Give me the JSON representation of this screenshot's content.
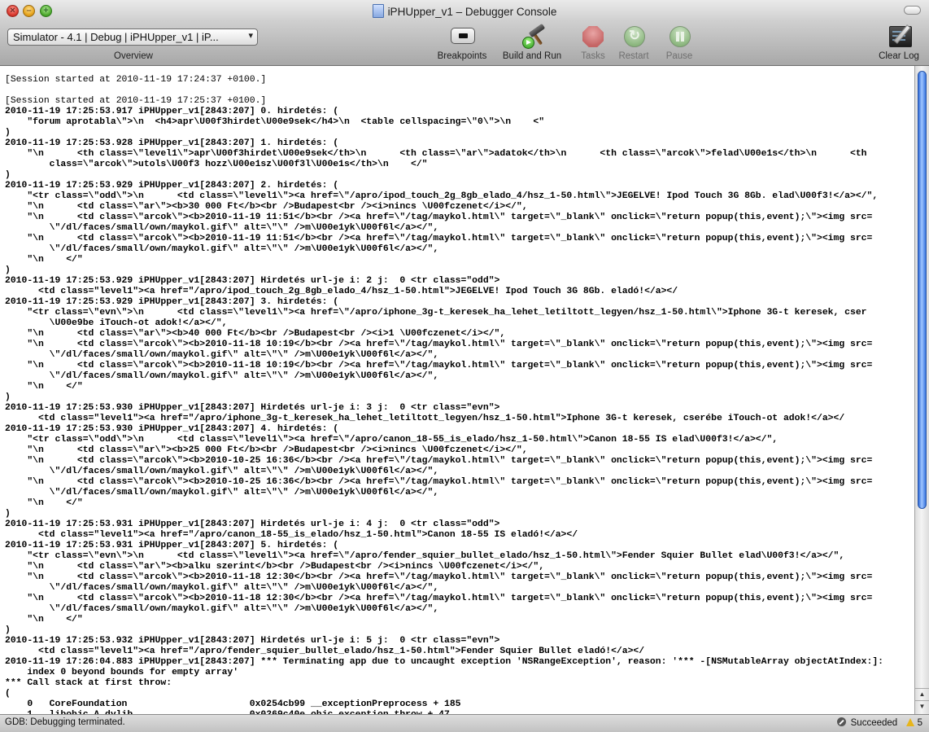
{
  "window": {
    "title": "iPHUpper_v1 – Debugger Console"
  },
  "toolbar": {
    "overview_selector": "Simulator - 4.1 | Debug | iPHUpper_v1 | iP...",
    "overview_label": "Overview",
    "items": [
      {
        "label": "Breakpoints",
        "icon": "breakpoints-icon",
        "enabled": true
      },
      {
        "label": "Build and Run",
        "icon": "hammer-play-icon",
        "enabled": true
      },
      {
        "label": "Tasks",
        "icon": "stop-icon",
        "enabled": false
      },
      {
        "label": "Restart",
        "icon": "restart-icon",
        "enabled": false
      },
      {
        "label": "Pause",
        "icon": "pause-icon",
        "enabled": false
      },
      {
        "label": "Clear Log",
        "icon": "clear-log-icon",
        "enabled": true
      }
    ]
  },
  "console": {
    "lines": [
      {
        "t": "[Session started at 2010-11-19 17:24:37 +0100.]",
        "b": false
      },
      {
        "t": "",
        "b": false
      },
      {
        "t": "[Session started at 2010-11-19 17:25:37 +0100.]",
        "b": false
      },
      {
        "t": "2010-11-19 17:25:53.917 iPHUpper_v1[2843:207] 0. hirdetés: (",
        "b": true
      },
      {
        "t": "    \"forum aprotabla\\\">\\n  <h4>apr\\U00f3hirdet\\U00e9sek</h4>\\n  <table cellspacing=\\\"0\\\">\\n    <\"",
        "b": true
      },
      {
        "t": ")",
        "b": true
      },
      {
        "t": "2010-11-19 17:25:53.928 iPHUpper_v1[2843:207] 1. hirdetés: (",
        "b": true
      },
      {
        "t": "    \"\\n      <th class=\\\"level1\\\">apr\\U00f3hirdet\\U00e9sek</th>\\n      <th class=\\\"ar\\\">adatok</th>\\n      <th class=\\\"arcok\\\">felad\\U00e1s</th>\\n      <th",
        "b": true
      },
      {
        "t": "        class=\\\"arcok\\\">utols\\U00f3 hozz\\U00e1sz\\U00f3l\\U00e1s</th>\\n    </\"",
        "b": true
      },
      {
        "t": ")",
        "b": true
      },
      {
        "t": "2010-11-19 17:25:53.929 iPHUpper_v1[2843:207] 2. hirdetés: (",
        "b": true
      },
      {
        "t": "    \"<tr class=\\\"odd\\\">\\n      <td class=\\\"level1\\\"><a href=\\\"/apro/ipod_touch_2g_8gb_elado_4/hsz_1-50.html\\\">JEGELVE! Ipod Touch 3G 8Gb. elad\\U00f3!</a></\",",
        "b": true
      },
      {
        "t": "    \"\\n      <td class=\\\"ar\\\"><b>30 000 Ft</b><br />Budapest<br /><i>nincs \\U00fczenet</i></\",",
        "b": true
      },
      {
        "t": "    \"\\n      <td class=\\\"arcok\\\"><b>2010-11-19 11:51</b><br /><a href=\\\"/tag/maykol.html\\\" target=\\\"_blank\\\" onclick=\\\"return popup(this,event);\\\"><img src=",
        "b": true
      },
      {
        "t": "        \\\"/dl/faces/small/own/maykol.gif\\\" alt=\\\"\\\" />m\\U00e1yk\\U00f6l</a></\",",
        "b": true
      },
      {
        "t": "    \"\\n      <td class=\\\"arcok\\\"><b>2010-11-19 11:51</b><br /><a href=\\\"/tag/maykol.html\\\" target=\\\"_blank\\\" onclick=\\\"return popup(this,event);\\\"><img src=",
        "b": true
      },
      {
        "t": "        \\\"/dl/faces/small/own/maykol.gif\\\" alt=\\\"\\\" />m\\U00e1yk\\U00f6l</a></\",",
        "b": true
      },
      {
        "t": "    \"\\n    </\"",
        "b": true
      },
      {
        "t": ")",
        "b": true
      },
      {
        "t": "2010-11-19 17:25:53.929 iPHUpper_v1[2843:207] Hirdetés url-je i: 2 j:  0 <tr class=\"odd\">",
        "b": true
      },
      {
        "t": "      <td class=\"level1\"><a href=\"/apro/ipod_touch_2g_8gb_elado_4/hsz_1-50.html\">JEGELVE! Ipod Touch 3G 8Gb. eladó!</a></",
        "b": true
      },
      {
        "t": "2010-11-19 17:25:53.929 iPHUpper_v1[2843:207] 3. hirdetés: (",
        "b": true
      },
      {
        "t": "    \"<tr class=\\\"evn\\\">\\n      <td class=\\\"level1\\\"><a href=\\\"/apro/iphone_3g-t_keresek_ha_lehet_letiltott_legyen/hsz_1-50.html\\\">Iphone 3G-t keresek, cser",
        "b": true
      },
      {
        "t": "        \\U00e9be iTouch-ot adok!</a></\",",
        "b": true
      },
      {
        "t": "    \"\\n      <td class=\\\"ar\\\"><b>40 000 Ft</b><br />Budapest<br /><i>1 \\U00fczenet</i></\",",
        "b": true
      },
      {
        "t": "    \"\\n      <td class=\\\"arcok\\\"><b>2010-11-18 10:19</b><br /><a href=\\\"/tag/maykol.html\\\" target=\\\"_blank\\\" onclick=\\\"return popup(this,event);\\\"><img src=",
        "b": true
      },
      {
        "t": "        \\\"/dl/faces/small/own/maykol.gif\\\" alt=\\\"\\\" />m\\U00e1yk\\U00f6l</a></\",",
        "b": true
      },
      {
        "t": "    \"\\n      <td class=\\\"arcok\\\"><b>2010-11-18 10:19</b><br /><a href=\\\"/tag/maykol.html\\\" target=\\\"_blank\\\" onclick=\\\"return popup(this,event);\\\"><img src=",
        "b": true
      },
      {
        "t": "        \\\"/dl/faces/small/own/maykol.gif\\\" alt=\\\"\\\" />m\\U00e1yk\\U00f6l</a></\",",
        "b": true
      },
      {
        "t": "    \"\\n    </\"",
        "b": true
      },
      {
        "t": ")",
        "b": true
      },
      {
        "t": "2010-11-19 17:25:53.930 iPHUpper_v1[2843:207] Hirdetés url-je i: 3 j:  0 <tr class=\"evn\">",
        "b": true
      },
      {
        "t": "      <td class=\"level1\"><a href=\"/apro/iphone_3g-t_keresek_ha_lehet_letiltott_legyen/hsz_1-50.html\">Iphone 3G-t keresek, cserébe iTouch-ot adok!</a></",
        "b": true
      },
      {
        "t": "2010-11-19 17:25:53.930 iPHUpper_v1[2843:207] 4. hirdetés: (",
        "b": true
      },
      {
        "t": "    \"<tr class=\\\"odd\\\">\\n      <td class=\\\"level1\\\"><a href=\\\"/apro/canon_18-55_is_elado/hsz_1-50.html\\\">Canon 18-55 IS elad\\U00f3!</a></\",",
        "b": true
      },
      {
        "t": "    \"\\n      <td class=\\\"ar\\\"><b>25 000 Ft</b><br />Budapest<br /><i>nincs \\U00fczenet</i></\",",
        "b": true
      },
      {
        "t": "    \"\\n      <td class=\\\"arcok\\\"><b>2010-10-25 16:36</b><br /><a href=\\\"/tag/maykol.html\\\" target=\\\"_blank\\\" onclick=\\\"return popup(this,event);\\\"><img src=",
        "b": true
      },
      {
        "t": "        \\\"/dl/faces/small/own/maykol.gif\\\" alt=\\\"\\\" />m\\U00e1yk\\U00f6l</a></\",",
        "b": true
      },
      {
        "t": "    \"\\n      <td class=\\\"arcok\\\"><b>2010-10-25 16:36</b><br /><a href=\\\"/tag/maykol.html\\\" target=\\\"_blank\\\" onclick=\\\"return popup(this,event);\\\"><img src=",
        "b": true
      },
      {
        "t": "        \\\"/dl/faces/small/own/maykol.gif\\\" alt=\\\"\\\" />m\\U00e1yk\\U00f6l</a></\",",
        "b": true
      },
      {
        "t": "    \"\\n    </\"",
        "b": true
      },
      {
        "t": ")",
        "b": true
      },
      {
        "t": "2010-11-19 17:25:53.931 iPHUpper_v1[2843:207] Hirdetés url-je i: 4 j:  0 <tr class=\"odd\">",
        "b": true
      },
      {
        "t": "      <td class=\"level1\"><a href=\"/apro/canon_18-55_is_elado/hsz_1-50.html\">Canon 18-55 IS eladó!</a></",
        "b": true
      },
      {
        "t": "2010-11-19 17:25:53.931 iPHUpper_v1[2843:207] 5. hirdetés: (",
        "b": true
      },
      {
        "t": "    \"<tr class=\\\"evn\\\">\\n      <td class=\\\"level1\\\"><a href=\\\"/apro/fender_squier_bullet_elado/hsz_1-50.html\\\">Fender Squier Bullet elad\\U00f3!</a></\",",
        "b": true
      },
      {
        "t": "    \"\\n      <td class=\\\"ar\\\"><b>alku szerint</b><br />Budapest<br /><i>nincs \\U00fczenet</i></\",",
        "b": true
      },
      {
        "t": "    \"\\n      <td class=\\\"arcok\\\"><b>2010-11-18 12:30</b><br /><a href=\\\"/tag/maykol.html\\\" target=\\\"_blank\\\" onclick=\\\"return popup(this,event);\\\"><img src=",
        "b": true
      },
      {
        "t": "        \\\"/dl/faces/small/own/maykol.gif\\\" alt=\\\"\\\" />m\\U00e1yk\\U00f6l</a></\",",
        "b": true
      },
      {
        "t": "    \"\\n      <td class=\\\"arcok\\\"><b>2010-11-18 12:30</b><br /><a href=\\\"/tag/maykol.html\\\" target=\\\"_blank\\\" onclick=\\\"return popup(this,event);\\\"><img src=",
        "b": true
      },
      {
        "t": "        \\\"/dl/faces/small/own/maykol.gif\\\" alt=\\\"\\\" />m\\U00e1yk\\U00f6l</a></\",",
        "b": true
      },
      {
        "t": "    \"\\n    </\"",
        "b": true
      },
      {
        "t": ")",
        "b": true
      },
      {
        "t": "2010-11-19 17:25:53.932 iPHUpper_v1[2843:207] Hirdetés url-je i: 5 j:  0 <tr class=\"evn\">",
        "b": true
      },
      {
        "t": "      <td class=\"level1\"><a href=\"/apro/fender_squier_bullet_elado/hsz_1-50.html\">Fender Squier Bullet eladó!</a></",
        "b": true
      },
      {
        "t": "2010-11-19 17:26:04.883 iPHUpper_v1[2843:207] *** Terminating app due to uncaught exception 'NSRangeException', reason: '*** -[NSMutableArray objectAtIndex:]:",
        "b": true
      },
      {
        "t": "    index 0 beyond bounds for empty array'",
        "b": true
      },
      {
        "t": "*** Call stack at first throw:",
        "b": true
      },
      {
        "t": "(",
        "b": true
      },
      {
        "t": "    0   CoreFoundation                      0x0254cb99 __exceptionPreprocess + 185",
        "b": true
      },
      {
        "t": "    1   libobjc.A.dylib                     0x0269c40e objc_exception_throw + 47",
        "b": true
      }
    ]
  },
  "statusbar": {
    "message": "GDB: Debugging terminated.",
    "result": "Succeeded",
    "warning_count": "5"
  }
}
